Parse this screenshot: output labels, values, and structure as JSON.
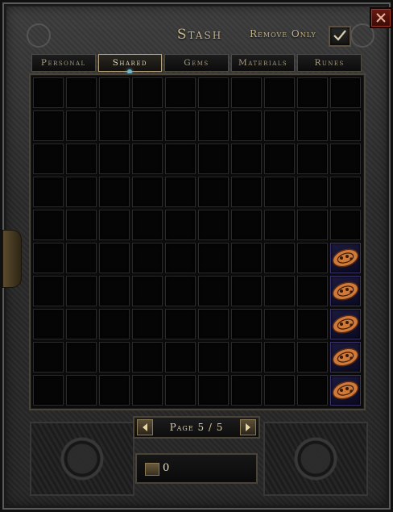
{
  "window": {
    "title": "Stash"
  },
  "remove_only": {
    "label": "Remove Only",
    "checked": true
  },
  "tabs": [
    {
      "label": "Personal",
      "active": false
    },
    {
      "label": "Shared",
      "active": true
    },
    {
      "label": "Gems",
      "active": false
    },
    {
      "label": "Materials",
      "active": false
    },
    {
      "label": "Runes",
      "active": false
    }
  ],
  "grid": {
    "rows": 10,
    "cols": 10,
    "items": [
      {
        "row": 5,
        "col": 9,
        "name": "amulet-item"
      },
      {
        "row": 6,
        "col": 9,
        "name": "amulet-item"
      },
      {
        "row": 7,
        "col": 9,
        "name": "amulet-item"
      },
      {
        "row": 8,
        "col": 9,
        "name": "amulet-item"
      },
      {
        "row": 9,
        "col": 9,
        "name": "amulet-item"
      }
    ]
  },
  "pager": {
    "label": "Page 5 / 5"
  },
  "gold": {
    "value": "0",
    "icon": "gold-chest-icon"
  },
  "colors": {
    "text_gold": "#c9b88c",
    "filled_slot": "#1c1a3e",
    "item": "#d07a3a"
  }
}
